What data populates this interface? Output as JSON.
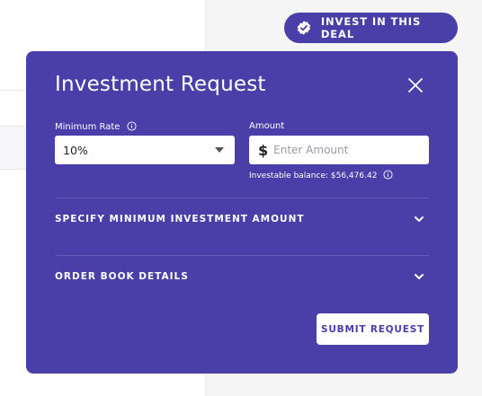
{
  "header": {
    "invest_button_label": "INVEST IN THIS DEAL",
    "invest_button_icon": "verified-badge-icon"
  },
  "modal": {
    "title": "Investment Request",
    "close_icon": "close-icon",
    "minimum_rate": {
      "label": "Minimum Rate",
      "selected_value": "10%",
      "info_icon": "info-icon"
    },
    "amount": {
      "label": "Amount",
      "currency_symbol": "$",
      "value": "",
      "placeholder": "Enter Amount",
      "balance_note": "Investable balance: $56,476.42",
      "info_icon": "info-icon"
    },
    "sections": [
      {
        "label": "SPECIFY MINIMUM INVESTMENT AMOUNT",
        "icon": "chevron-down-icon"
      },
      {
        "label": "ORDER BOOK DETAILS",
        "icon": "chevron-down-icon"
      }
    ],
    "submit_label": "SUBMIT REQUEST"
  },
  "colors": {
    "brand_purple": "#4a3fa8",
    "background": "#f5f5f6",
    "white": "#ffffff"
  }
}
